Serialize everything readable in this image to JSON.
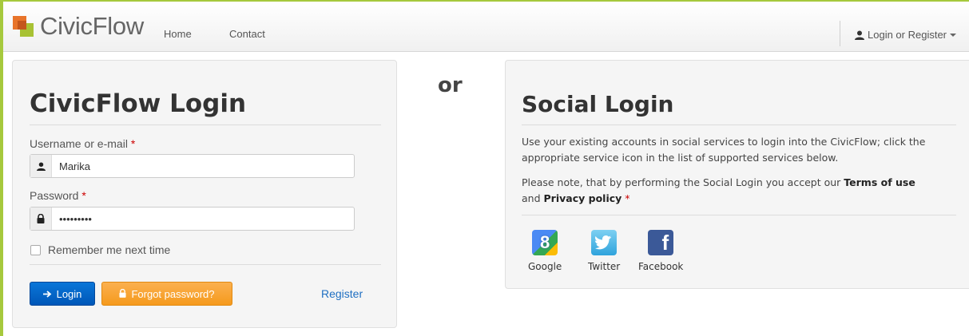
{
  "app": {
    "brand": "CivicFlow",
    "nav": {
      "home": "Home",
      "contact": "Contact",
      "login_register": "Login or Register"
    }
  },
  "login": {
    "title": "CivicFlow Login",
    "username_label": "Username or e-mail",
    "username_value": "Marika",
    "password_label": "Password",
    "password_value": "•••••••••",
    "required_mark": "*",
    "remember_label": "Remember me next time",
    "login_button": "Login",
    "forgot_button": "Forgot password?",
    "register_link": "Register"
  },
  "separator": "or",
  "social": {
    "title": "Social Login",
    "description": "Use your existing accounts in social services to login into the CivicFlow; click the appropriate service icon in the list of supported services below.",
    "note_prefix": "Please note, that by performing the Social Login you accept our",
    "terms": "Terms of use",
    "and": "and",
    "privacy": "Privacy policy",
    "required_mark": "*",
    "services": [
      {
        "name": "Google",
        "icon": "google-icon",
        "color": "#4a8af4"
      },
      {
        "name": "Twitter",
        "icon": "twitter-icon",
        "color": "#4fb8e8"
      },
      {
        "name": "Facebook",
        "icon": "facebook-icon",
        "color": "#3b5998"
      }
    ]
  },
  "colors": {
    "accent_frame": "#a6c93d",
    "primary_button": "#0a76d8",
    "warning_button": "#f59a1d",
    "link": "#1f6fc2",
    "required": "#cc0000"
  }
}
